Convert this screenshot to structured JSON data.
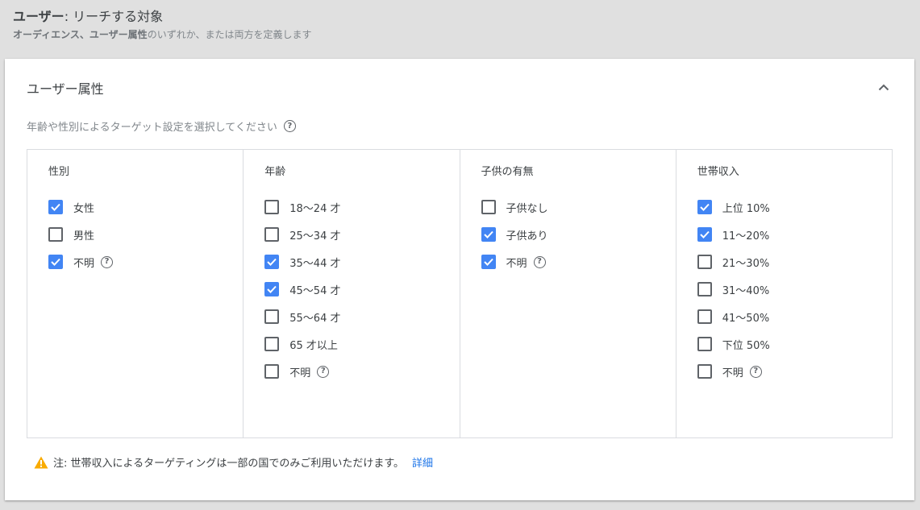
{
  "header": {
    "title_bold": "ユーザー",
    "title_rest": ": リーチする対象",
    "subtitle_a": "オーディエンス、",
    "subtitle_b": "ユーザー属性",
    "subtitle_c": "のいずれか、または両方を定義します"
  },
  "section": {
    "title": "ユーザー属性",
    "instruction": "年齢や性別によるターゲット設定を選択してください"
  },
  "colors": {
    "accent": "#4285f4",
    "warning": "#f9ab00",
    "link": "#1a73e8"
  },
  "columns": [
    {
      "heading": "性別",
      "options": [
        {
          "label": "女性",
          "checked": true,
          "help": false
        },
        {
          "label": "男性",
          "checked": false,
          "help": false
        },
        {
          "label": "不明",
          "checked": true,
          "help": true
        }
      ]
    },
    {
      "heading": "年齢",
      "options": [
        {
          "label": "18～24 才",
          "checked": false,
          "help": false
        },
        {
          "label": "25～34 才",
          "checked": false,
          "help": false
        },
        {
          "label": "35～44 才",
          "checked": true,
          "help": false
        },
        {
          "label": "45～54 才",
          "checked": true,
          "help": false
        },
        {
          "label": "55～64 才",
          "checked": false,
          "help": false
        },
        {
          "label": "65 才以上",
          "checked": false,
          "help": false
        },
        {
          "label": "不明",
          "checked": false,
          "help": true
        }
      ]
    },
    {
      "heading": "子供の有無",
      "options": [
        {
          "label": "子供なし",
          "checked": false,
          "help": false
        },
        {
          "label": "子供あり",
          "checked": true,
          "help": false
        },
        {
          "label": "不明",
          "checked": true,
          "help": true
        }
      ]
    },
    {
      "heading": "世帯収入",
      "options": [
        {
          "label": "上位 10%",
          "checked": true,
          "help": false
        },
        {
          "label": "11～20%",
          "checked": true,
          "help": false
        },
        {
          "label": "21～30%",
          "checked": false,
          "help": false
        },
        {
          "label": "31～40%",
          "checked": false,
          "help": false
        },
        {
          "label": "41～50%",
          "checked": false,
          "help": false
        },
        {
          "label": "下位 50%",
          "checked": false,
          "help": false
        },
        {
          "label": "不明",
          "checked": false,
          "help": true
        }
      ]
    }
  ],
  "note": {
    "text": "注: 世帯収入によるターゲティングは一部の国でのみご利用いただけます。",
    "link": "詳細"
  }
}
